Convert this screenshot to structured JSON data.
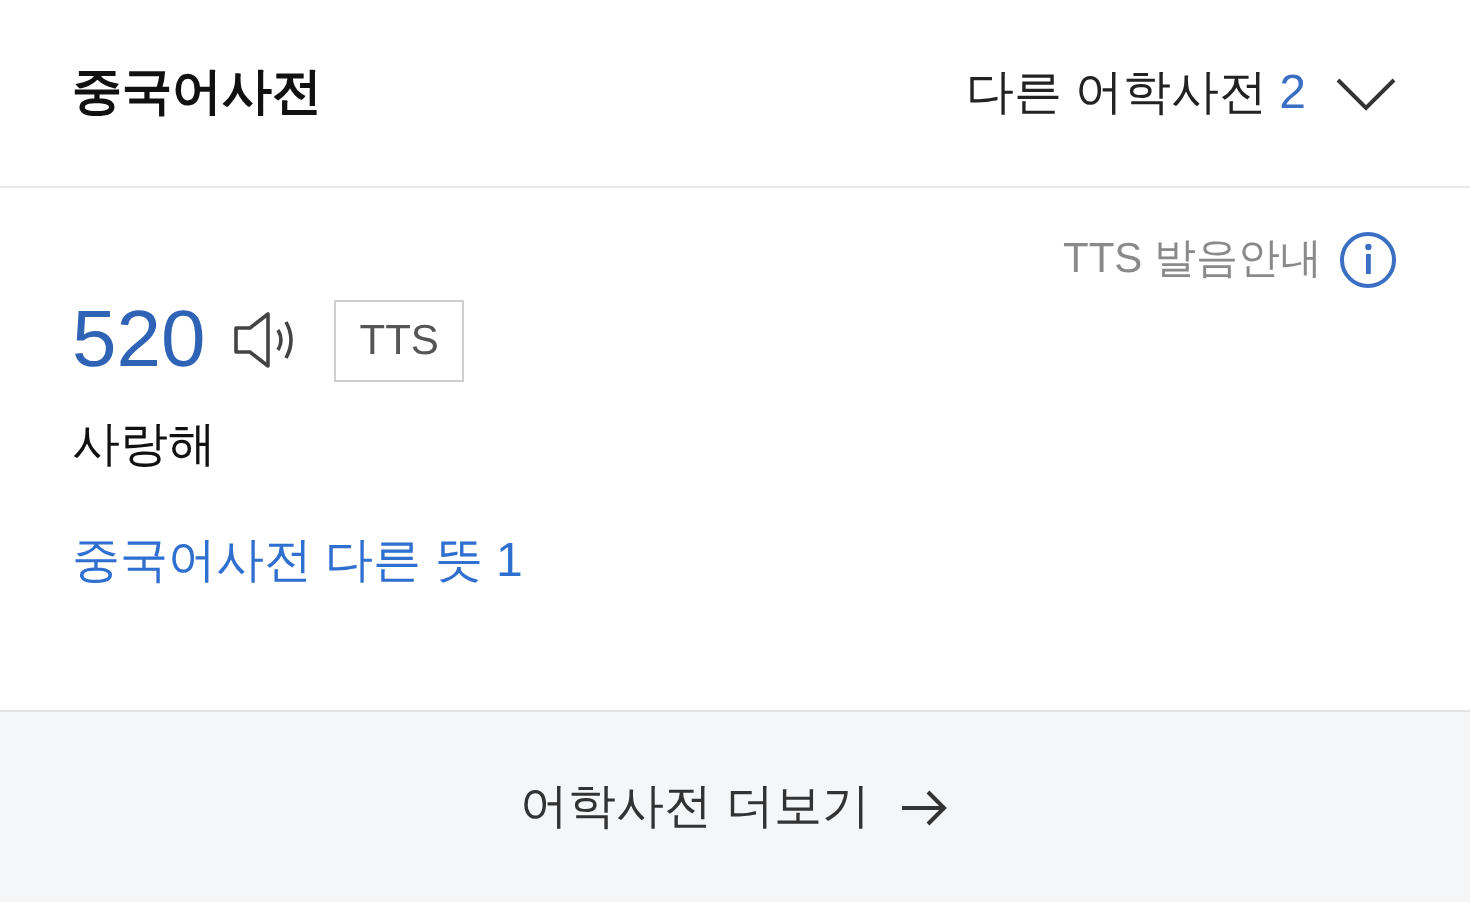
{
  "header": {
    "title": "중국어사전",
    "other_label": "다른 어학사전",
    "other_count": "2"
  },
  "tts_guide": {
    "label": "TTS 발음안내"
  },
  "entry": {
    "word": "520",
    "tts_badge": "TTS",
    "meaning": "사랑해",
    "more_meanings": "중국어사전 다른 뜻 1"
  },
  "footer": {
    "label": "어학사전 더보기"
  }
}
